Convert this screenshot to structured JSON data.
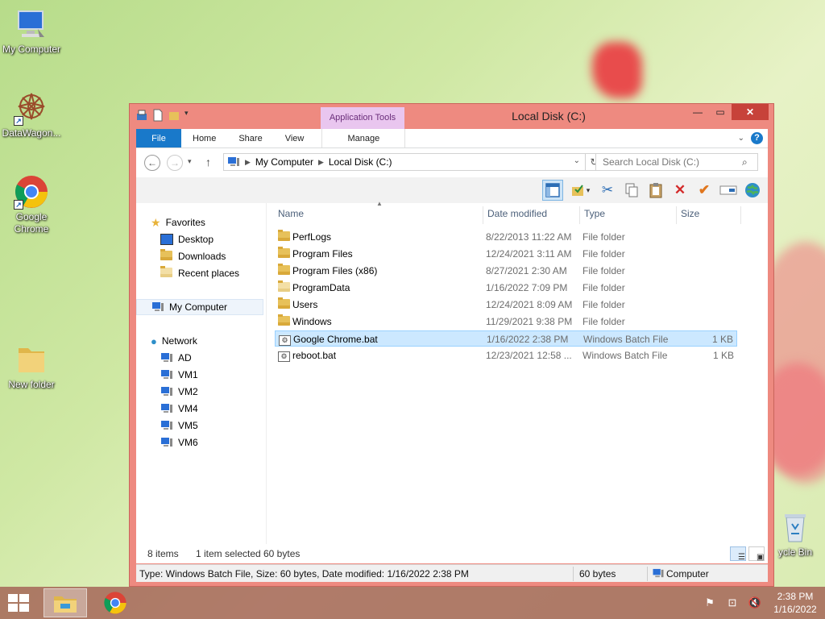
{
  "desktop": {
    "icons": [
      {
        "label": "My Computer"
      },
      {
        "label": "DataWagon..."
      },
      {
        "label": "Google Chrome"
      },
      {
        "label": "New folder"
      },
      {
        "label": "ycle Bin"
      }
    ]
  },
  "window": {
    "title": "Local Disk (C:)",
    "context_tab": "Application Tools",
    "ribbon_tabs": {
      "file": "File",
      "home": "Home",
      "share": "Share",
      "view": "View",
      "manage": "Manage"
    },
    "address": {
      "root": "My Computer",
      "current": "Local Disk (C:)"
    },
    "search_placeholder": "Search Local Disk (C:)",
    "nav": {
      "favorites": "Favorites",
      "desktop": "Desktop",
      "downloads": "Downloads",
      "recent": "Recent places",
      "my_computer": "My Computer",
      "network": "Network",
      "hosts": [
        "AD",
        "VM1",
        "VM2",
        "VM4",
        "VM5",
        "VM6"
      ]
    },
    "columns": {
      "name": "Name",
      "date": "Date modified",
      "type": "Type",
      "size": "Size"
    },
    "files": [
      {
        "name": "PerfLogs",
        "date": "8/22/2013 11:22 AM",
        "type": "File folder",
        "size": "",
        "kind": "folder"
      },
      {
        "name": "Program Files",
        "date": "12/24/2021 3:11 AM",
        "type": "File folder",
        "size": "",
        "kind": "folder"
      },
      {
        "name": "Program Files (x86)",
        "date": "8/27/2021 2:30 AM",
        "type": "File folder",
        "size": "",
        "kind": "folder"
      },
      {
        "name": "ProgramData",
        "date": "1/16/2022 7:09 PM",
        "type": "File folder",
        "size": "",
        "kind": "folder-pale"
      },
      {
        "name": "Users",
        "date": "12/24/2021 8:09 AM",
        "type": "File folder",
        "size": "",
        "kind": "folder"
      },
      {
        "name": "Windows",
        "date": "11/29/2021 9:38 PM",
        "type": "File folder",
        "size": "",
        "kind": "folder"
      },
      {
        "name": "Google Chrome.bat",
        "date": "1/16/2022 2:38 PM",
        "type": "Windows Batch File",
        "size": "1 KB",
        "kind": "bat"
      },
      {
        "name": "reboot.bat",
        "date": "12/23/2021 12:58 ...",
        "type": "Windows Batch File",
        "size": "1 KB",
        "kind": "bat"
      }
    ],
    "status": {
      "items": "8 items",
      "selected": "1 item selected",
      "bytes": "60 bytes"
    },
    "details_bar": {
      "info": "Type: Windows Batch File, Size: 60 bytes, Date modified: 1/16/2022 2:38 PM",
      "size": "60 bytes",
      "location": "Computer"
    }
  },
  "taskbar": {
    "time": "2:38 PM",
    "date": "1/16/2022"
  }
}
